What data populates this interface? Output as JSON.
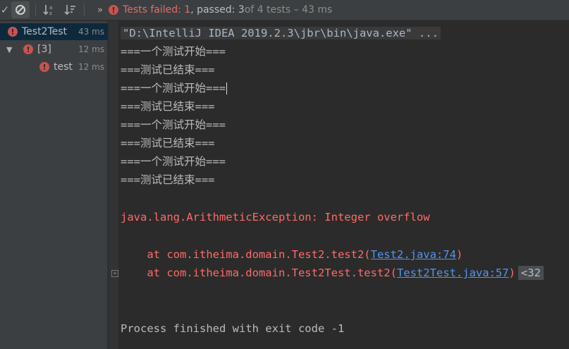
{
  "toolbar": {
    "check_icon": "checkmark-icon",
    "cancel_icon": "cancel-icon",
    "sort_alpha_icon": "sort-alphabetically-icon",
    "sort_duration_icon": "sort-by-duration-icon",
    "more_icon": "double-chevron-icon",
    "status": {
      "failed_text": "Tests failed: 1",
      "passed_text": ", passed: 3",
      "total_text": " of 4 tests – 43 ms"
    }
  },
  "tree": {
    "items": [
      {
        "name": "Test2Test",
        "duration": "43 ms",
        "status": "failed",
        "selected": true
      },
      {
        "name": "[3]",
        "duration": "12 ms",
        "status": "failed",
        "expanded": true
      },
      {
        "name": "test",
        "duration": "12 ms",
        "status": "failed"
      }
    ]
  },
  "console": {
    "command": "\"D:\\IntelliJ IDEA 2019.2.3\\jbr\\bin\\java.exe\" ...",
    "output_lines": [
      "===一个测试开始===",
      "===测试已结束===",
      "===一个测试开始===",
      "===测试已结束===",
      "===一个测试开始===",
      "===测试已结束===",
      "===一个测试开始===",
      "===测试已结束==="
    ],
    "exception": "java.lang.ArithmeticException: Integer overflow",
    "stack": [
      {
        "prefix": "    at com.itheima.domain.Test2.test2(",
        "link": "Test2.java:74",
        "suffix": ")"
      },
      {
        "prefix": "    at com.itheima.domain.Test2Test.test2(",
        "link": "Test2Test.java:57",
        "suffix": ")",
        "folded": "<32"
      }
    ],
    "exit_text": "Process finished with exit code -1"
  },
  "colors": {
    "error": "#ff6b68",
    "link": "#5394ec",
    "selection": "#0d293e",
    "panel": "#3c3f41",
    "editor": "#2b2b2b"
  }
}
